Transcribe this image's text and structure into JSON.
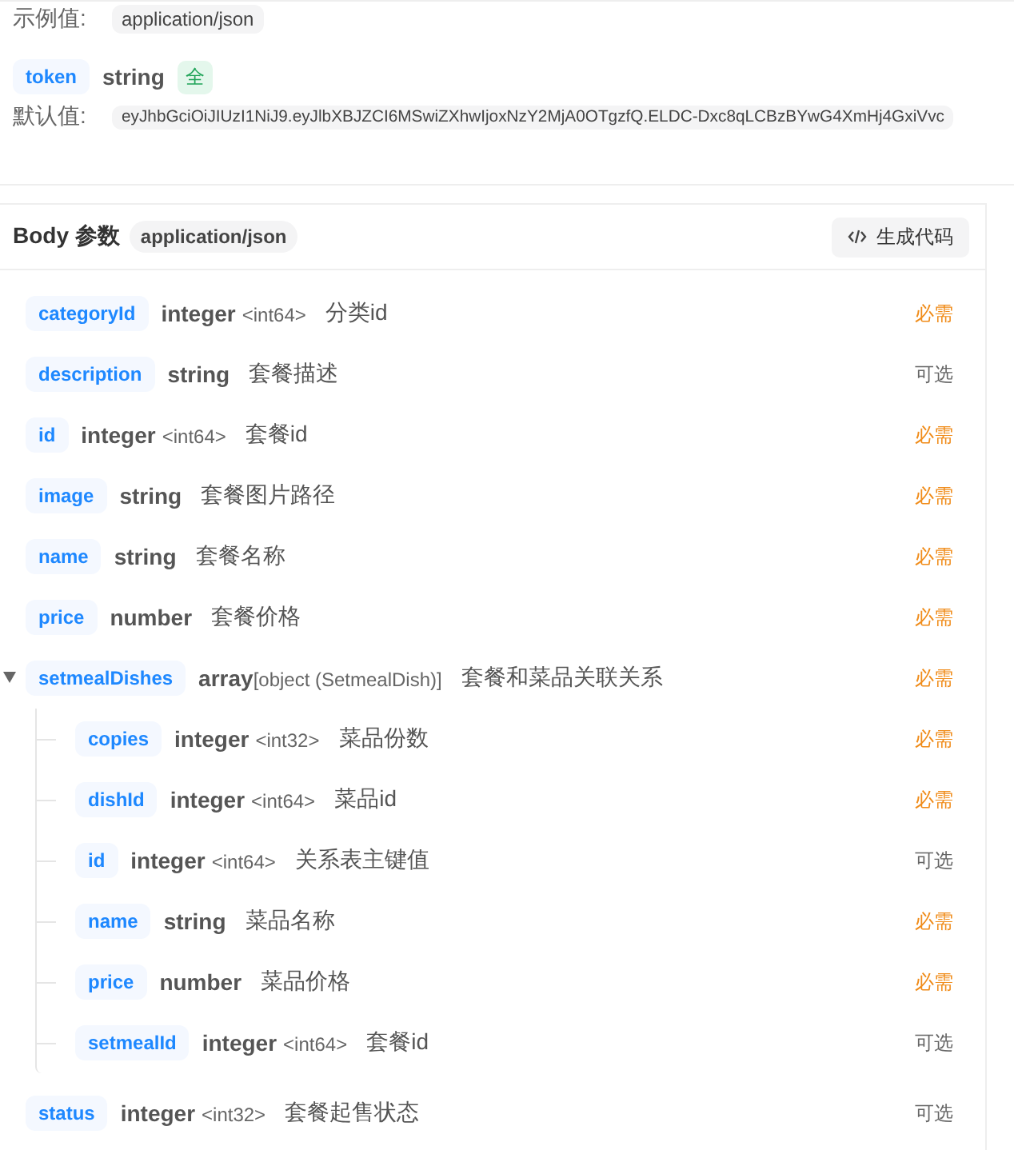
{
  "header_params": {
    "example": {
      "label": "示例值:",
      "value": "application/json"
    },
    "param": {
      "name": "token",
      "type": "string",
      "badge": "全",
      "default_label": "默认值:",
      "default_value": "eyJhbGciOiJIUzI1NiJ9.eyJlbXBJZCI6MSwiZXhwIjoxNzY2MjA0OTgzfQ.ELDC-Dxc8qLCBzBYwG4XmHj4GxiVvc"
    }
  },
  "body": {
    "title": "Body 参数",
    "content_type": "application/json",
    "generate_button": "生成代码",
    "fields": [
      {
        "name": "categoryId",
        "type": "integer",
        "format": "<int64>",
        "description": "分类id",
        "requirement": "必需",
        "required": true
      },
      {
        "name": "description",
        "type": "string",
        "description": "套餐描述",
        "requirement": "可选",
        "required": false
      },
      {
        "name": "id",
        "type": "integer",
        "format": "<int64>",
        "description": "套餐id",
        "requirement": "必需",
        "required": true
      },
      {
        "name": "image",
        "type": "string",
        "description": "套餐图片路径",
        "requirement": "必需",
        "required": true
      },
      {
        "name": "name",
        "type": "string",
        "description": "套餐名称",
        "requirement": "必需",
        "required": true
      },
      {
        "name": "price",
        "type": "number",
        "description": "套餐价格",
        "requirement": "必需",
        "required": true
      },
      {
        "name": "setmealDishes",
        "type": "array",
        "format": "[object (SetmealDish)]",
        "description": "套餐和菜品关联关系",
        "requirement": "必需",
        "required": true,
        "expanded": true,
        "children": [
          {
            "name": "copies",
            "type": "integer",
            "format": "<int32>",
            "description": "菜品份数",
            "requirement": "必需",
            "required": true
          },
          {
            "name": "dishId",
            "type": "integer",
            "format": "<int64>",
            "description": "菜品id",
            "requirement": "必需",
            "required": true
          },
          {
            "name": "id",
            "type": "integer",
            "format": "<int64>",
            "description": "关系表主键值",
            "requirement": "可选",
            "required": false
          },
          {
            "name": "name",
            "type": "string",
            "description": "菜品名称",
            "requirement": "必需",
            "required": true
          },
          {
            "name": "price",
            "type": "number",
            "description": "菜品价格",
            "requirement": "必需",
            "required": true
          },
          {
            "name": "setmealId",
            "type": "integer",
            "format": "<int64>",
            "description": "套餐id",
            "requirement": "可选",
            "required": false
          }
        ]
      },
      {
        "name": "status",
        "type": "integer",
        "format": "<int32>",
        "description": "套餐起售状态",
        "requirement": "可选",
        "required": false
      }
    ]
  }
}
